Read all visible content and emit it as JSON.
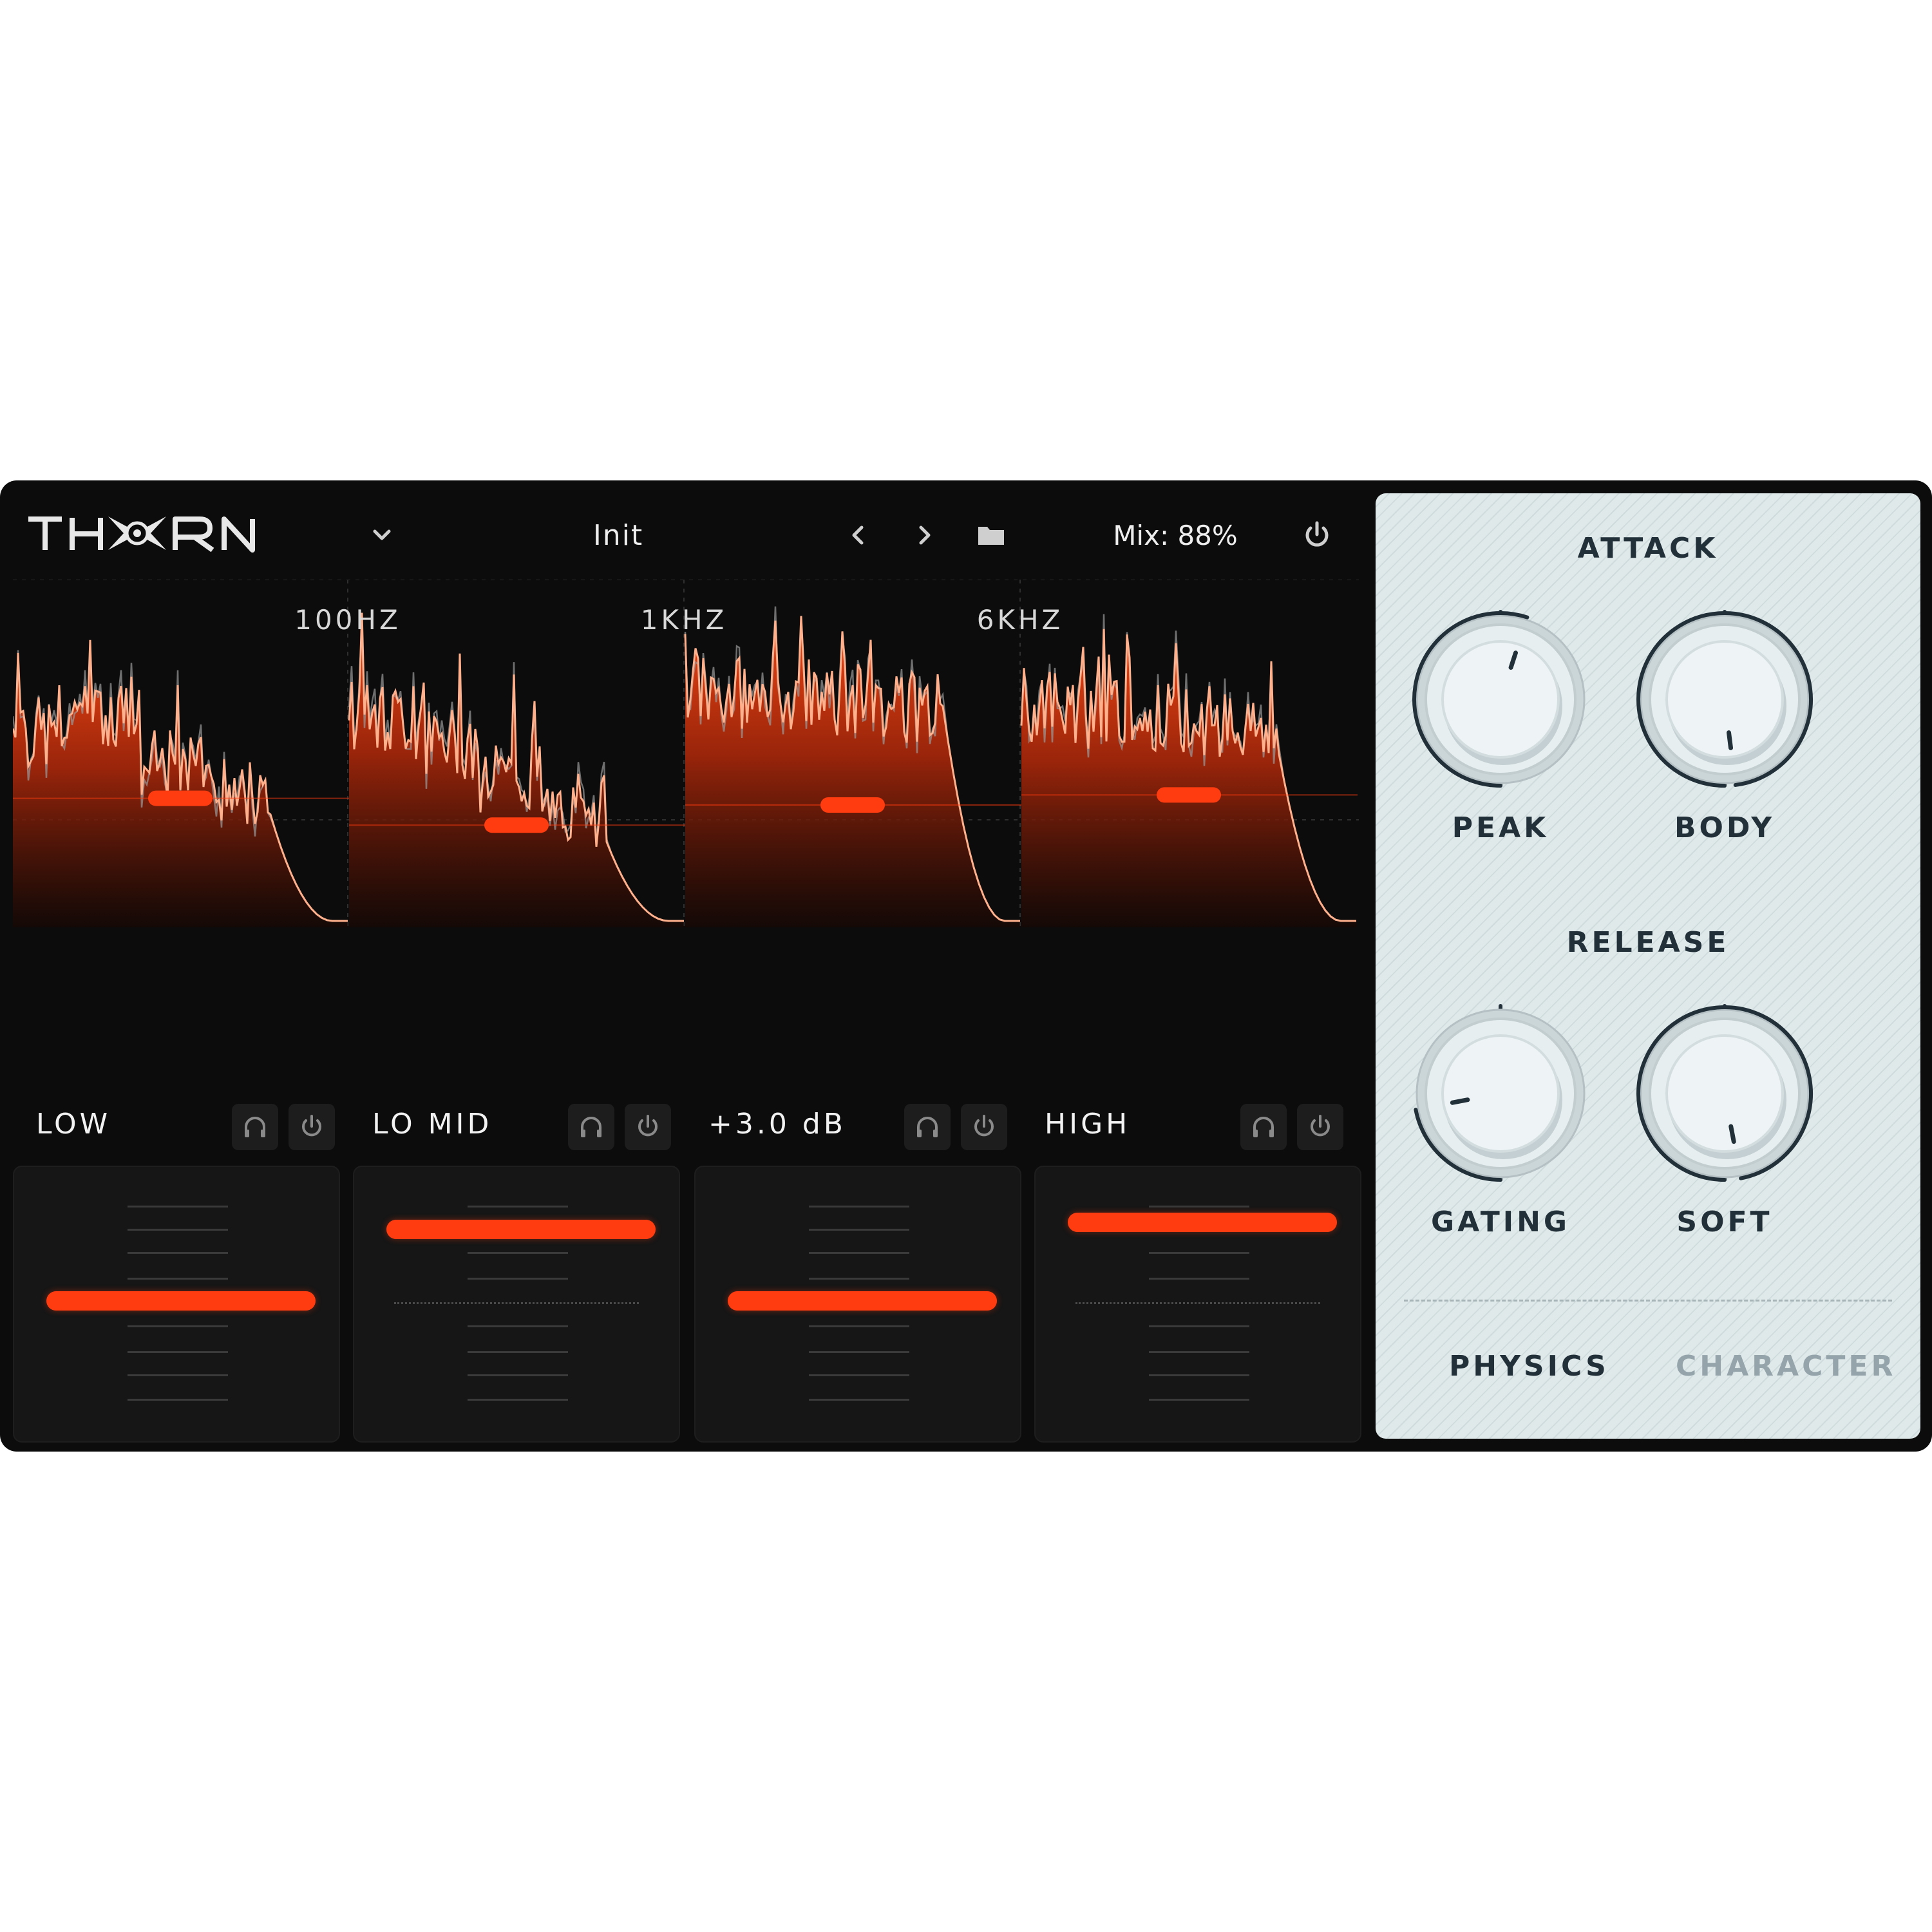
{
  "app": {
    "logo_text": "THORN",
    "preset": "Init",
    "mix_label": "Mix: 88%"
  },
  "toolbar": {
    "icons": [
      "chevron-down-icon",
      "chevron-left-icon",
      "chevron-right-icon",
      "folder-icon",
      "power-icon"
    ]
  },
  "crossovers": [
    "100HZ",
    "1KHZ",
    "6KHZ"
  ],
  "bands": [
    {
      "name": "LOW",
      "gain_level": 0.48,
      "threshold_level": 0.52
    },
    {
      "name": "LO MID",
      "gain_level": 0.77,
      "threshold_level": 0.44
    },
    {
      "name": "+3.0 dB",
      "gain_level": 0.48,
      "threshold_level": 0.5
    },
    {
      "name": "HIGH",
      "gain_level": 0.8,
      "threshold_level": 0.53
    }
  ],
  "side_panel": {
    "attack": {
      "title": "ATTACK",
      "knobs": [
        {
          "label": "PEAK",
          "value": 0.55
        },
        {
          "label": "BODY",
          "value": 0.98
        }
      ]
    },
    "release": {
      "title": "RELEASE",
      "knobs": [
        {
          "label": "GATING",
          "value": 0.22
        },
        {
          "label": "SOFT",
          "value": 0.97
        }
      ]
    },
    "tabs": [
      {
        "label": "PHYSICS",
        "active": true
      },
      {
        "label": "CHARACTER",
        "active": false
      }
    ]
  },
  "colors": {
    "accent": "#ff3c10",
    "background": "#0c0c0c",
    "panel": "#dfe9ea",
    "panel_text": "#22303a"
  }
}
